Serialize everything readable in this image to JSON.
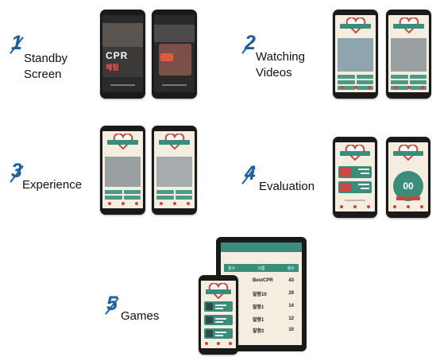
{
  "steps": [
    {
      "number": "1",
      "label_line1": "Standby",
      "label_line2": "Screen"
    },
    {
      "number": "2",
      "label_line1": "Watching",
      "label_line2": "Videos"
    },
    {
      "number": "3",
      "label_line1": "Experience",
      "label_line2": ""
    },
    {
      "number": "4",
      "label_line1": "Evaluation",
      "label_line2": ""
    },
    {
      "number": "5",
      "label_line1": "Games",
      "label_line2": ""
    }
  ],
  "standby": {
    "title": "CPR",
    "subtitle": "체험"
  },
  "evaluation": {
    "timer": "00"
  },
  "games": {
    "columns": [
      "점수",
      "이름",
      "점수"
    ],
    "rows": [
      {
        "name": "BestCPR",
        "score": "43"
      },
      {
        "name": "잘함10",
        "score": "29"
      },
      {
        "name": "잘함1",
        "score": "14"
      },
      {
        "name": "잘함1",
        "score": "12"
      },
      {
        "name": "잘함2",
        "score": "10"
      }
    ]
  },
  "colors": {
    "accent": "#1f5f9e",
    "teal": "#3a8c7b",
    "red": "#c9483f",
    "cream": "#f4ede0"
  }
}
